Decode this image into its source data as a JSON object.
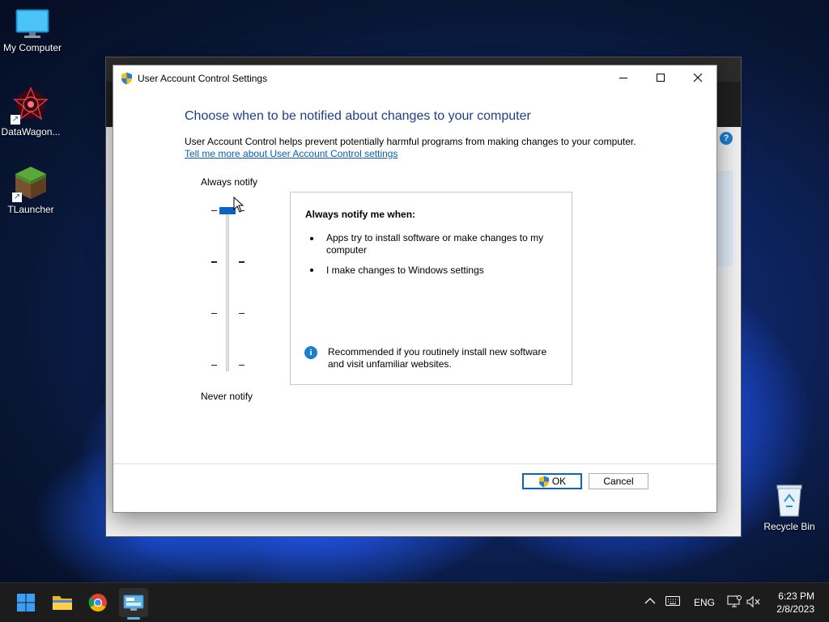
{
  "desktop": {
    "icons": [
      {
        "label": "My Computer"
      },
      {
        "label": "DataWagon..."
      },
      {
        "label": "TLauncher"
      },
      {
        "label": "Recycle Bin"
      }
    ]
  },
  "dialog": {
    "title": "User Account Control Settings",
    "heading": "Choose when to be notified about changes to your computer",
    "description": "User Account Control helps prevent potentially harmful programs from making changes to your computer.",
    "link": "Tell me more about User Account Control settings",
    "slider": {
      "top_label": "Always notify",
      "bottom_label": "Never notify",
      "level_count": 4,
      "selected_level": 4
    },
    "info": {
      "title": "Always notify me when:",
      "bullets": [
        "Apps try to install software or make changes to my computer",
        "I make changes to Windows settings"
      ],
      "recommendation": "Recommended if you routinely install new software and visit unfamiliar websites."
    },
    "buttons": {
      "ok": "OK",
      "cancel": "Cancel"
    }
  },
  "taskbar": {
    "language": "ENG",
    "time": "6:23 PM",
    "date": "2/8/2023"
  },
  "colors": {
    "accent": "#0a64c8",
    "heading": "#1e3f8c",
    "link": "#0d5bb5"
  }
}
